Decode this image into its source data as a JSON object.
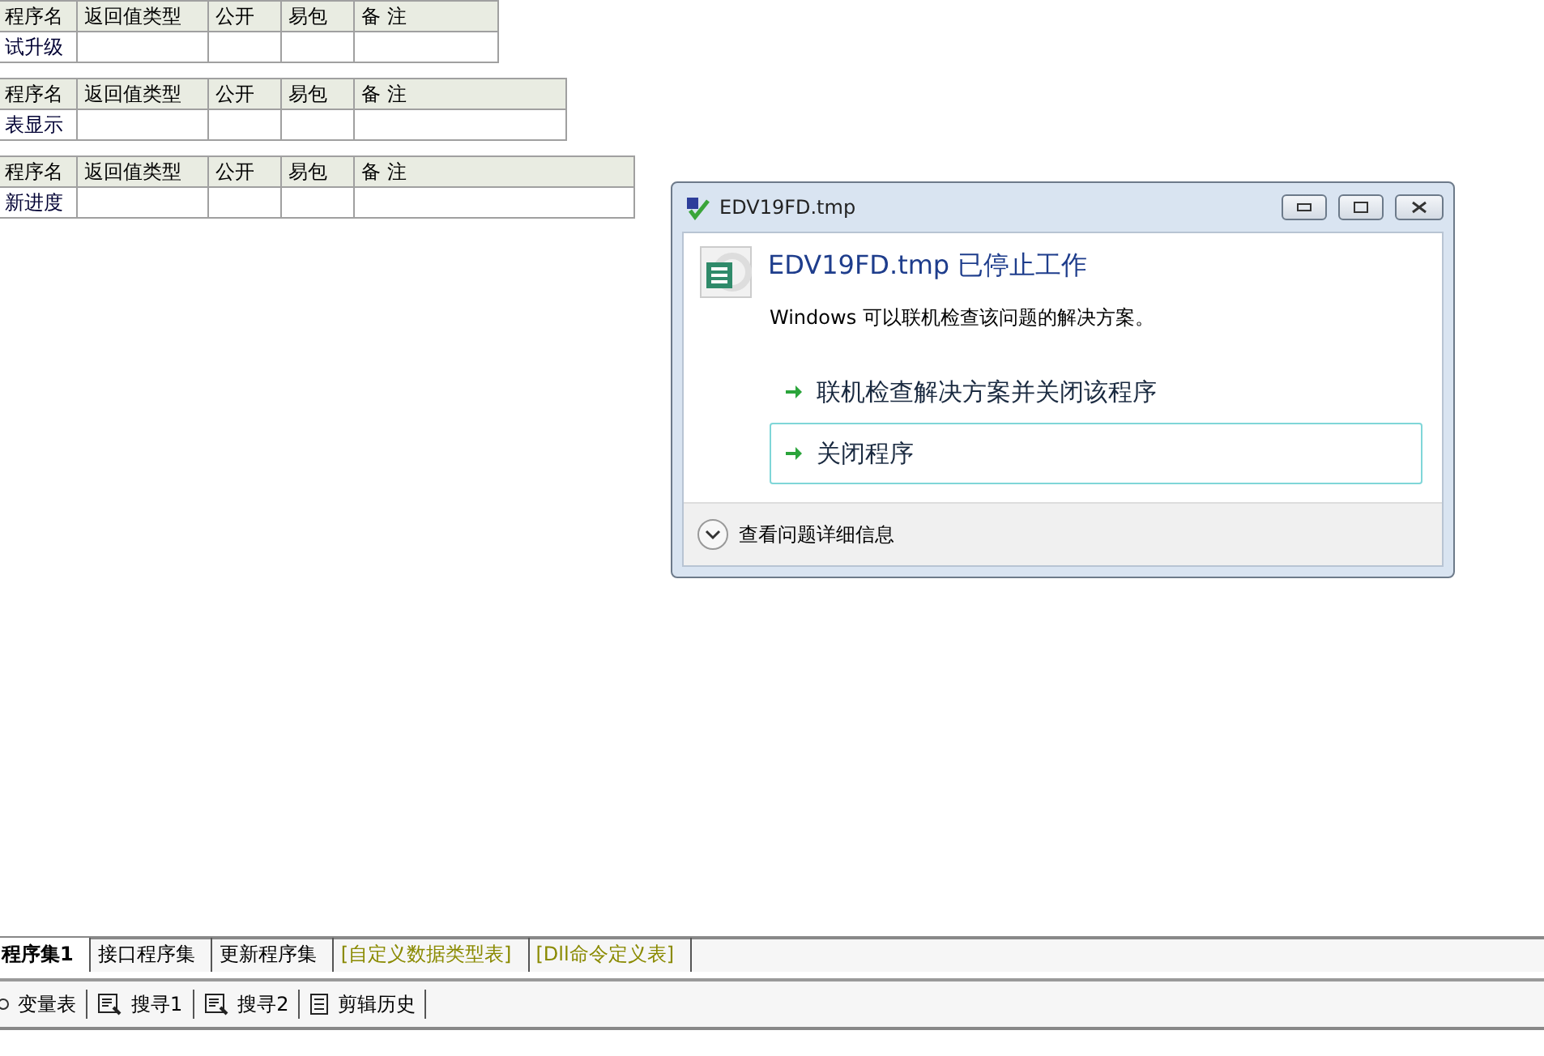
{
  "tables": [
    {
      "columns": [
        "程序名",
        "返回值类型",
        "公开",
        "易包",
        "备 注"
      ],
      "rows": [
        [
          "试升级",
          "",
          "",
          "",
          ""
        ]
      ]
    },
    {
      "columns": [
        "程序名",
        "返回值类型",
        "公开",
        "易包",
        "备 注"
      ],
      "rows": [
        [
          "表显示",
          "",
          "",
          "",
          ""
        ]
      ]
    },
    {
      "columns": [
        "程序名",
        "返回值类型",
        "公开",
        "易包",
        "备 注"
      ],
      "rows": [
        [
          "新进度",
          "",
          "",
          "",
          ""
        ]
      ]
    }
  ],
  "dialog": {
    "title": "EDV19FD.tmp",
    "heading": "EDV19FD.tmp 已停止工作",
    "message": "Windows 可以联机检查该问题的解决方案。",
    "options": [
      {
        "label": "联机检查解决方案并关闭该程序",
        "selected": false
      },
      {
        "label": "关闭程序",
        "selected": true
      }
    ],
    "details": "查看问题详细信息"
  },
  "tabs": [
    {
      "label": "程序集1",
      "selected": true,
      "kind": "code"
    },
    {
      "label": "接口程序集",
      "selected": false,
      "kind": "code"
    },
    {
      "label": "更新程序集",
      "selected": false,
      "kind": "code"
    },
    {
      "label": "[自定义数据类型表]",
      "selected": false,
      "kind": "table"
    },
    {
      "label": "[Dll命令定义表]",
      "selected": false,
      "kind": "table"
    }
  ],
  "toolbar": [
    {
      "label": "变量表",
      "kind": "vars"
    },
    {
      "label": "搜寻1",
      "kind": "search"
    },
    {
      "label": "搜寻2",
      "kind": "search"
    },
    {
      "label": "剪辑历史",
      "kind": "history"
    }
  ]
}
